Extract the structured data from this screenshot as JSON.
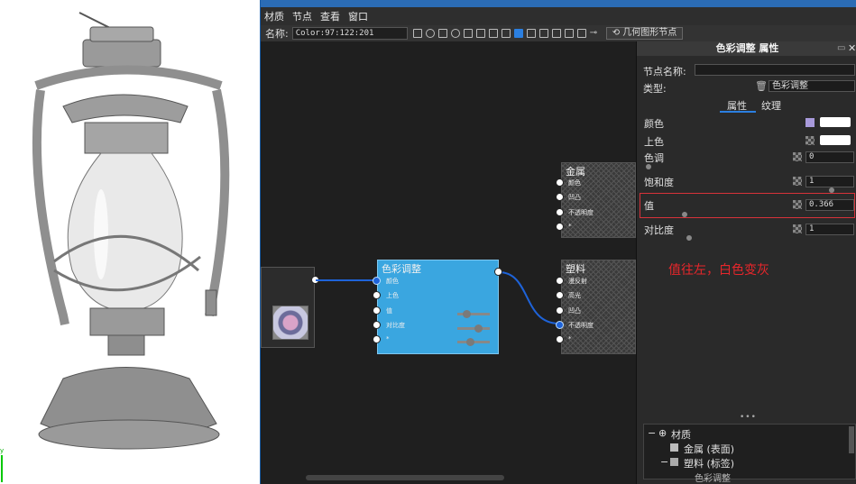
{
  "menu": [
    "材质",
    "节点",
    "查看",
    "窗口"
  ],
  "toolbar": {
    "name_label": "名称:",
    "name_value": "Color:97:122:201",
    "geometry_node_label": "几何图形节点"
  },
  "nodes": {
    "color_adjust": {
      "title": "色彩调整",
      "ports": [
        "颜色",
        "上色",
        "值",
        "对比度",
        "*"
      ],
      "color": "#3aa6e0"
    },
    "metal": {
      "title": "金属",
      "ports": [
        "颜色",
        "凹凸",
        "不透明度",
        "*"
      ]
    },
    "plastic": {
      "title": "塑料",
      "ports": [
        "漫反射",
        "高光",
        "凹凸",
        "不透明度",
        "*"
      ]
    }
  },
  "properties": {
    "header": "色彩调整 属性",
    "node_name_label": "节点名称:",
    "node_name_value": "",
    "type_label": "类型:",
    "type_value": "色彩调整",
    "tabs": [
      "属性",
      "纹理"
    ],
    "rows": [
      {
        "label": "颜色",
        "value": ""
      },
      {
        "label": "上色",
        "value": ""
      },
      {
        "label": "色调",
        "value": "0"
      },
      {
        "label": "饱和度",
        "value": "1"
      },
      {
        "label": "值",
        "value": "0.366"
      },
      {
        "label": "对比度",
        "value": "1"
      }
    ],
    "annotation": "值往左，白色变灰",
    "annotation_color": "#e8262b",
    "highlight_color": "#d8323a"
  },
  "tree": {
    "root": "材质",
    "children": [
      "金属 (表面)",
      "塑料 (标签)"
    ],
    "grandchild": "色彩调整"
  },
  "colors": {
    "accent": "#2b7fe0",
    "node_blue": "#3aa6e0",
    "link": "#1e63d9"
  }
}
